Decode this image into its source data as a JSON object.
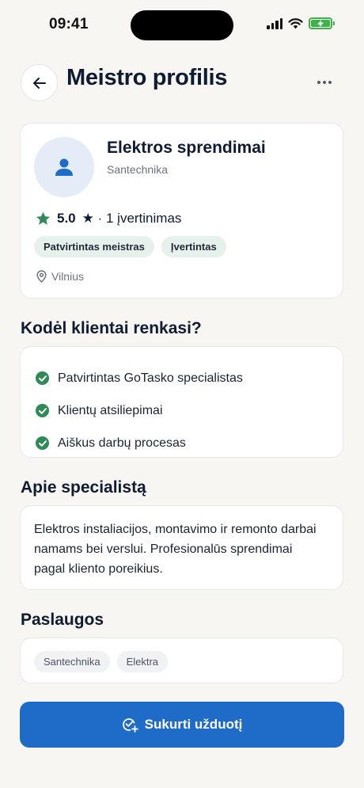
{
  "status_bar": {
    "time": "09:41"
  },
  "header": {
    "title": "Meistro profilis"
  },
  "profile": {
    "name": "Elektros sprendimai",
    "category": "Santechnika",
    "rating_value": "5.0",
    "rating_suffix": "★ · 1 įvertinimas",
    "badges": [
      "Patvirtintas meistras",
      "Įvertintas"
    ],
    "location": "Vilnius"
  },
  "why": {
    "title": "Kodėl klientai renkasi?",
    "items": [
      "Patvirtintas GoTasko specialistas",
      "Klientų atsiliepimai",
      "Aiškus darbų procesas"
    ]
  },
  "about": {
    "title": "Apie specialistą",
    "text": "Elektros instaliacijos, montavimo ir remonto darbai namams bei verslui. Profesionalūs sprendimai pagal kliento poreikius."
  },
  "services": {
    "title": "Paslaugos",
    "tags": [
      "Santechnika",
      "Elektra"
    ]
  },
  "cta": {
    "label": "Sukurti užduotį"
  },
  "colors": {
    "primary": "#1f6bc8",
    "success": "#2e8b57",
    "badge_bg": "#e6f1ec",
    "background": "#f7f6f3"
  }
}
